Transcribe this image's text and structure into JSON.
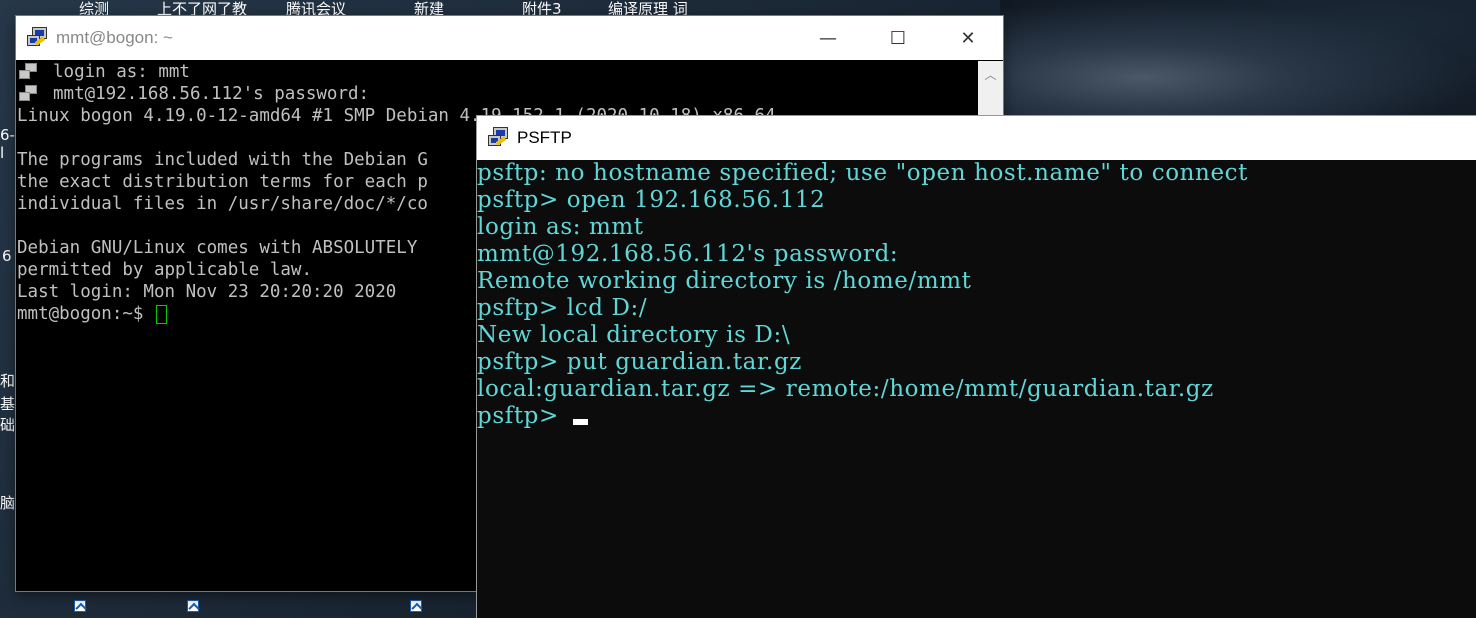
{
  "desktop": {
    "shortcuts": [
      "综测",
      "上不了网了教",
      "腾讯会议",
      "新建",
      "附件3",
      "编译原理 词"
    ],
    "edge_labels": [
      "6-l",
      "6",
      "和",
      "基础",
      "脑"
    ]
  },
  "putty": {
    "title": "mmt@bogon: ~",
    "controls": {
      "minimize": "—",
      "maximize": "☐",
      "close": "✕"
    },
    "lines": [
      "login as: mmt",
      "mmt@192.168.56.112's password:",
      "Linux bogon 4.19.0-12-amd64 #1 SMP Debian 4.19.152-1 (2020-10-18) x86_64",
      "",
      "The programs included with the Debian G",
      "the exact distribution terms for each p",
      "individual files in /usr/share/doc/*/co",
      "",
      "Debian GNU/Linux comes with ABSOLUTELY",
      "permitted by applicable law.",
      "Last login: Mon Nov 23 20:20:20 2020",
      "mmt@bogon:~$ "
    ],
    "colors": {
      "text": "#c0c0c0",
      "background": "#000000",
      "cursor": "#00cc00"
    }
  },
  "psftp": {
    "title": "PSFTP",
    "lines": [
      "psftp: no hostname specified; use \"open host.name\" to connect",
      "psftp> open 192.168.56.112",
      "login as: mmt",
      "mmt@192.168.56.112's password:",
      "Remote working directory is /home/mmt",
      "psftp> lcd D:/",
      "New local directory is D:\\",
      "psftp> put guardian.tar.gz",
      "local:guardian.tar.gz => remote:/home/mmt/guardian.tar.gz",
      "psftp> "
    ],
    "colors": {
      "text": "#61d6d6",
      "background": "#0c0c0c"
    }
  }
}
